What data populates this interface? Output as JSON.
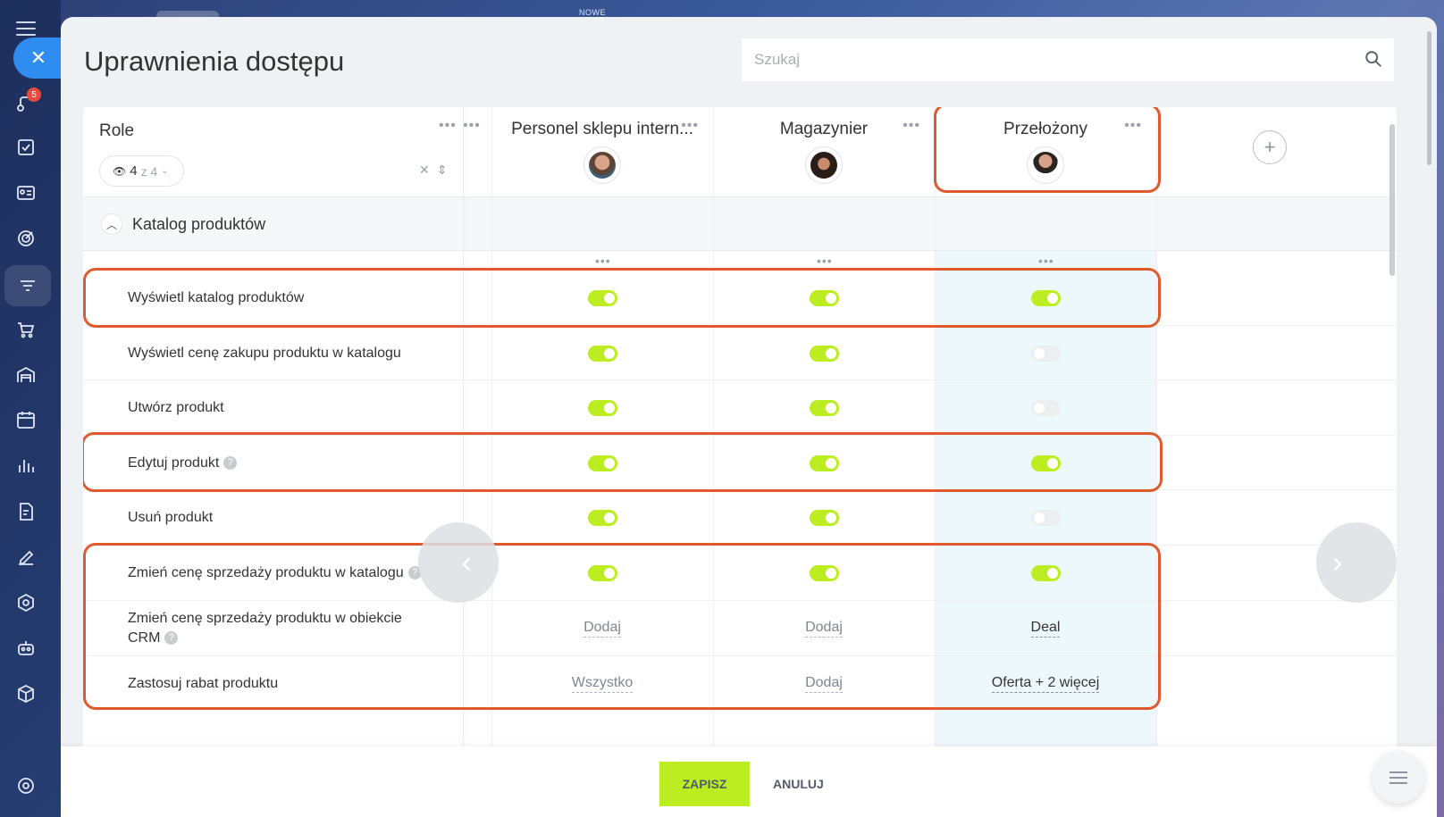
{
  "top": {
    "new_label": "NOWE"
  },
  "sidebar": {
    "badge_count": "5"
  },
  "page": {
    "title": "Uprawnienia dostępu"
  },
  "search": {
    "placeholder": "Szukaj"
  },
  "header": {
    "roles_label": "Role",
    "visible_count": "4",
    "total_count": "z 4",
    "columns": [
      {
        "name": "Personel sklepu intern...",
        "avatar": "man-avatar"
      },
      {
        "name": "Magazynier",
        "avatar": "woman-avatar"
      },
      {
        "name": "Przełożony",
        "avatar": "man-suit-avatar"
      }
    ]
  },
  "section": {
    "title": "Katalog produktów"
  },
  "rows": [
    {
      "label": "Wyświetl katalog produktów",
      "help": false,
      "values": [
        "on",
        "on",
        "on"
      ]
    },
    {
      "label": "Wyświetl cenę zakupu produktu w katalogu",
      "help": false,
      "values": [
        "on",
        "on",
        "off"
      ]
    },
    {
      "label": "Utwórz produkt",
      "help": false,
      "values": [
        "on",
        "on",
        "off"
      ]
    },
    {
      "label": "Edytuj produkt",
      "help": true,
      "values": [
        "on",
        "on",
        "on"
      ]
    },
    {
      "label": "Usuń produkt",
      "help": false,
      "values": [
        "on",
        "on",
        "off"
      ]
    },
    {
      "label": "Zmień cenę sprzedaży produktu w katalogu",
      "help": true,
      "values": [
        "on",
        "on",
        "on"
      ]
    },
    {
      "label_line1": "Zmień cenę sprzedaży produktu w obiekcie",
      "label_line2": "CRM",
      "help": true,
      "values": [
        "Dodaj",
        "Dodaj",
        "Deal"
      ]
    },
    {
      "label": "Zastosuj rabat produktu",
      "help": false,
      "values": [
        "Wszystko",
        "Dodaj",
        "Oferta + 2 więcej"
      ]
    }
  ],
  "footer": {
    "save_label": "ZAPISZ",
    "cancel_label": "ANULUJ"
  },
  "colors": {
    "accent_green": "#bbed21",
    "annotation_red": "#e05a2e",
    "highlight_col": "#edf8fd",
    "close_blue": "#2f8cf0"
  }
}
